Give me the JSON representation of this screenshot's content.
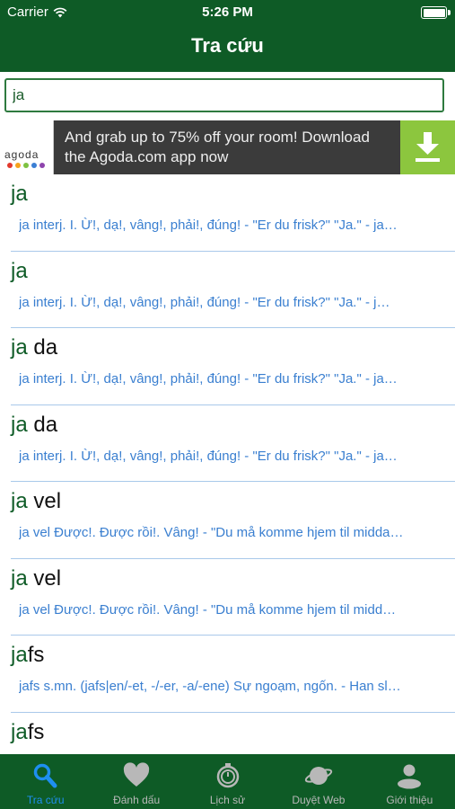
{
  "status": {
    "carrier": "Carrier",
    "time": "5:26 PM"
  },
  "nav": {
    "title": "Tra cứu"
  },
  "search": {
    "value": "ja"
  },
  "ad": {
    "text": "And grab up to 75% off your room! Download the Agoda.com app now",
    "logo_text": "agoda",
    "dot_colors": [
      "#e2392d",
      "#f6a21c",
      "#7ec242",
      "#3b7fd4",
      "#8e44ad"
    ]
  },
  "results": [
    {
      "match": "ja",
      "rest": "",
      "def": "ja  interj.    I. Ừ!, dạ!, vâng!, phải!, đúng! -  \"Er du frisk?\" \"Ja.\" -  ja…"
    },
    {
      "match": "ja",
      "rest": "",
      "def": "ja  interj.     I. Ừ!, dạ!, vâng!, phải!, đúng!  -  \"Er du frisk?\" \"Ja.\"  -  j…"
    },
    {
      "match": "ja",
      "rest": " da",
      "def": "ja  interj.     I. Ừ!, dạ!, vâng!, phải!, đúng!  -  \"Er du frisk?\" \"Ja.\"  -  ja…"
    },
    {
      "match": "ja",
      "rest": " da",
      "def": "ja  interj.     I. Ừ!, dạ!, vâng!, phải!, đúng!  -  \"Er du frisk?\" \"Ja.\"  -  ja…"
    },
    {
      "match": "ja",
      "rest": " vel",
      "def": "ja vel    Được!. Được rồi!. Vâng! -  \"Du må komme hjem til midda…"
    },
    {
      "match": "ja",
      "rest": " vel",
      "def": "ja vel     Được!. Được rồi!. Vâng!  -  \"Du må komme hjem til midd…"
    },
    {
      "match": "ja",
      "rest": "fs",
      "def": "jafs  s.mn. (jafs|en/-et, -/-er, -a/-ene)     Sự ngoạm, ngốn. -  Han sl…"
    },
    {
      "match": "ja",
      "rest": "fs",
      "def": ""
    }
  ],
  "tabs": [
    {
      "label": "Tra cứu",
      "icon": "search-icon",
      "active": true
    },
    {
      "label": "Đánh dấu",
      "icon": "heart-icon",
      "active": false
    },
    {
      "label": "Lịch sử",
      "icon": "history-icon",
      "active": false
    },
    {
      "label": "Duyệt Web",
      "icon": "globe-icon",
      "active": false
    },
    {
      "label": "Giới thiệu",
      "icon": "user-icon",
      "active": false
    }
  ],
  "colors": {
    "primary": "#0e5b26",
    "link": "#3a7fd0",
    "tab_active": "#1e8ff0",
    "ad_accent": "#8cc63e"
  }
}
